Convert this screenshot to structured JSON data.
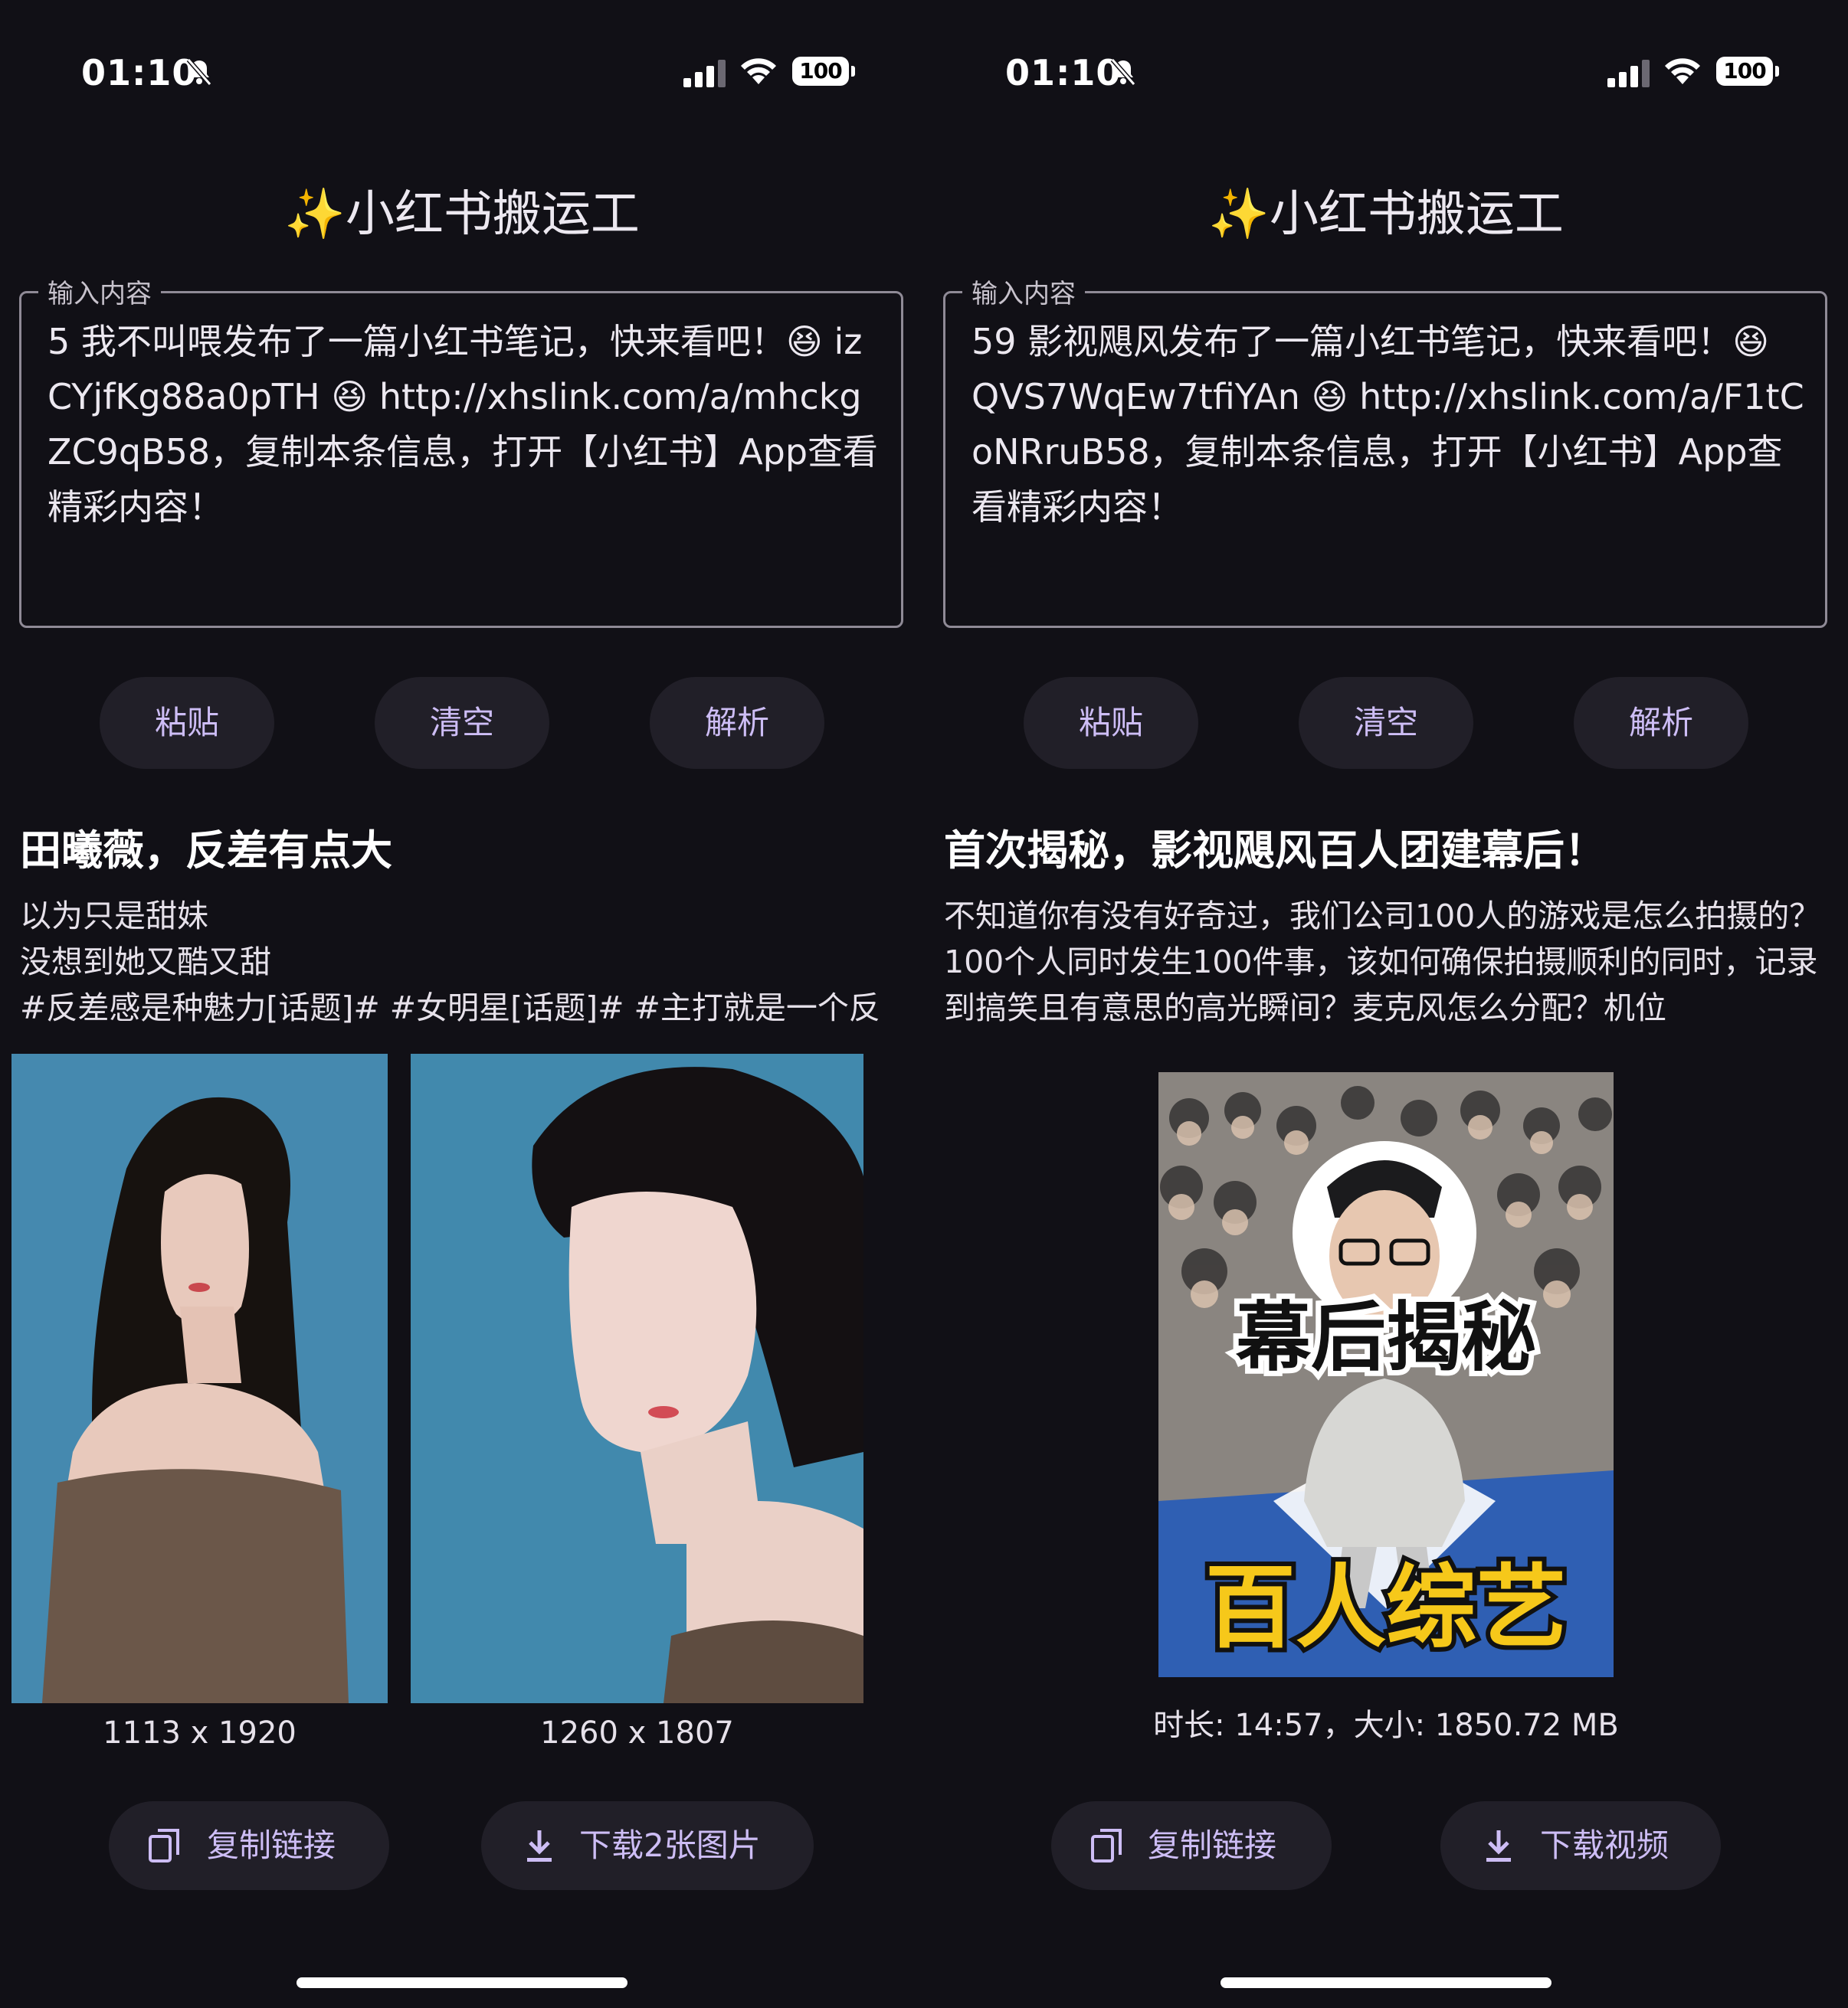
{
  "status_bar": {
    "time": "01:10",
    "battery": "100"
  },
  "app": {
    "title": "小红书搬运工",
    "title_emoji": "✨"
  },
  "left": {
    "input": {
      "label": "输入内容",
      "value": "5 我不叫喂发布了一篇小红书笔记，快来看吧！😆 izCYjfKg88a0pTH 😆 http://xhslink.com/a/mhckgZC9qB58，复制本条信息，打开【小红书】App查看精彩内容！"
    },
    "buttons": {
      "paste": "粘贴",
      "clear": "清空",
      "parse": "解析"
    },
    "post": {
      "title": "田曦薇，反差有点大",
      "body": "以为只是甜妹\n没想到她又酷又甜\n#反差感是种魅力[话题]# #女明星[话题]# #主打就是一个反"
    },
    "images": [
      {
        "caption": "1113 x 1920"
      },
      {
        "caption": "1260 x 1807"
      }
    ],
    "actions": {
      "copy_link": "复制链接",
      "download": "下载2张图片"
    }
  },
  "right": {
    "input": {
      "label": "输入内容",
      "value": "59 影视飓风发布了一篇小红书笔记，快来看吧！😆 QVS7WqEw7tfiYAn 😆 http://xhslink.com/a/F1tCoNRruB58，复制本条信息，打开【小红书】App查看精彩内容！"
    },
    "buttons": {
      "paste": "粘贴",
      "clear": "清空",
      "parse": "解析"
    },
    "post": {
      "title": "首次揭秘，影视飓风百人团建幕后！",
      "body": "不知道你有没有好奇过，我们公司100人的游戏是怎么拍摄的？100个人同时发生100件事，该如何确保拍摄顺利的同时，记录到搞笑且有意思的高光瞬间？麦克风怎么分配？机位"
    },
    "video": {
      "overlay_top": "幕后揭秘",
      "overlay_bottom": "百人综艺",
      "info": "时长: 14:57，大小: 1850.72 MB"
    },
    "actions": {
      "copy_link": "复制链接",
      "download": "下载视频"
    }
  },
  "colors": {
    "background": "#111016",
    "button_bg": "#211f28",
    "accent_text": "#cdbdf5",
    "photo_bg": "#3f84a8"
  }
}
